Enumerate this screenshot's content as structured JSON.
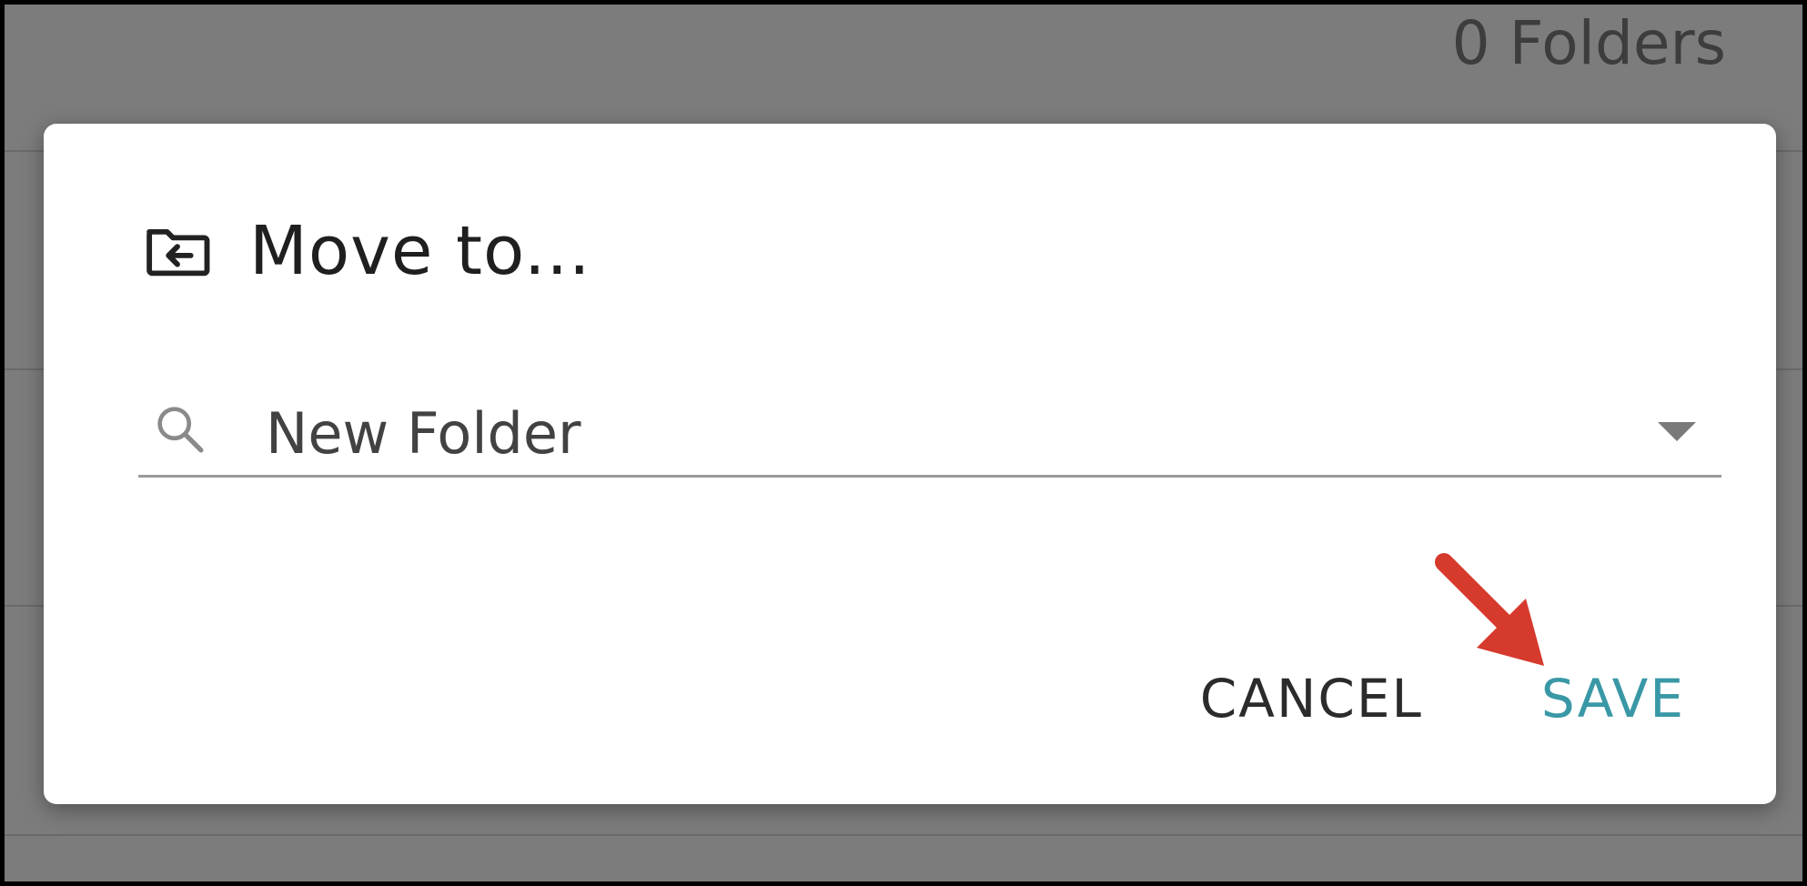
{
  "background": {
    "folder_count": "0 Folders"
  },
  "dialog": {
    "title": "Move to...",
    "title_icon": "folder-move-icon",
    "destination": {
      "value": "New Folder",
      "search_icon": "search-icon",
      "arrow_icon": "dropdown-arrow-icon"
    },
    "actions": {
      "cancel_label": "CANCEL",
      "save_label": "SAVE"
    }
  },
  "colors": {
    "save_accent": "#3a98a6",
    "annotation_arrow": "#d63a2c",
    "overlay": "#7c7c7c"
  }
}
